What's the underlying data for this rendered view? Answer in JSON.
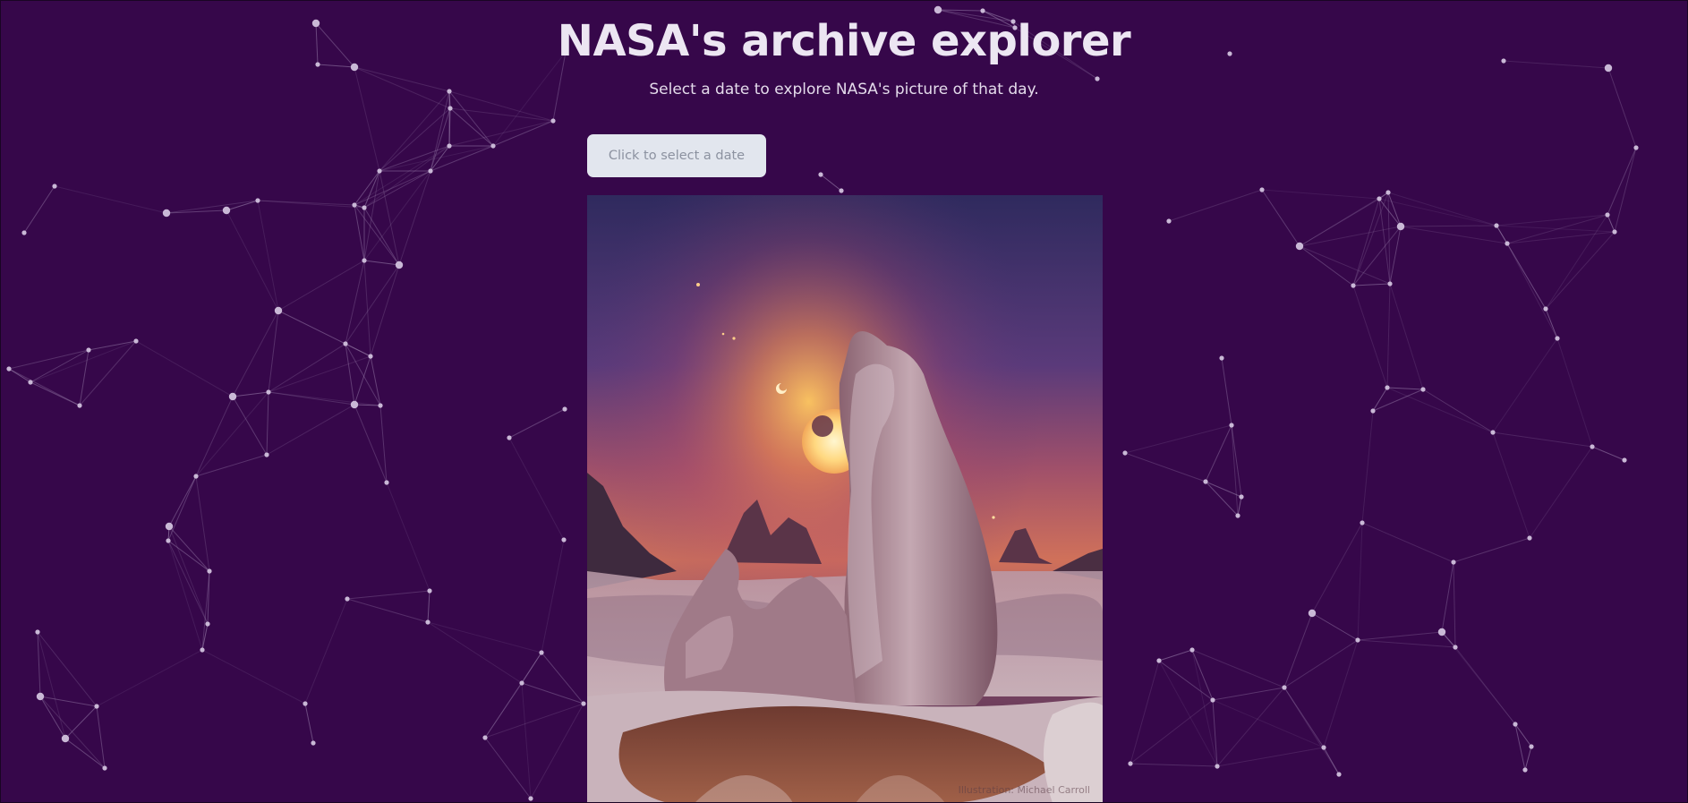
{
  "app": {
    "title": "NASA's archive explorer",
    "subtitle": "Select a date to explore NASA's picture of that day."
  },
  "date_picker": {
    "button_label": "Click to select a date"
  },
  "apod_image": {
    "subject": "alien landscape with tall rock spire, ringed sun and crescent moons",
    "credit": "Illustration: Michael Carroll"
  },
  "theme": {
    "background": "#36074a",
    "network_node": "#c7b6d4",
    "network_line": "#9f86b0",
    "button_bg": "#e2e6ee",
    "button_text": "#8c92a0"
  }
}
